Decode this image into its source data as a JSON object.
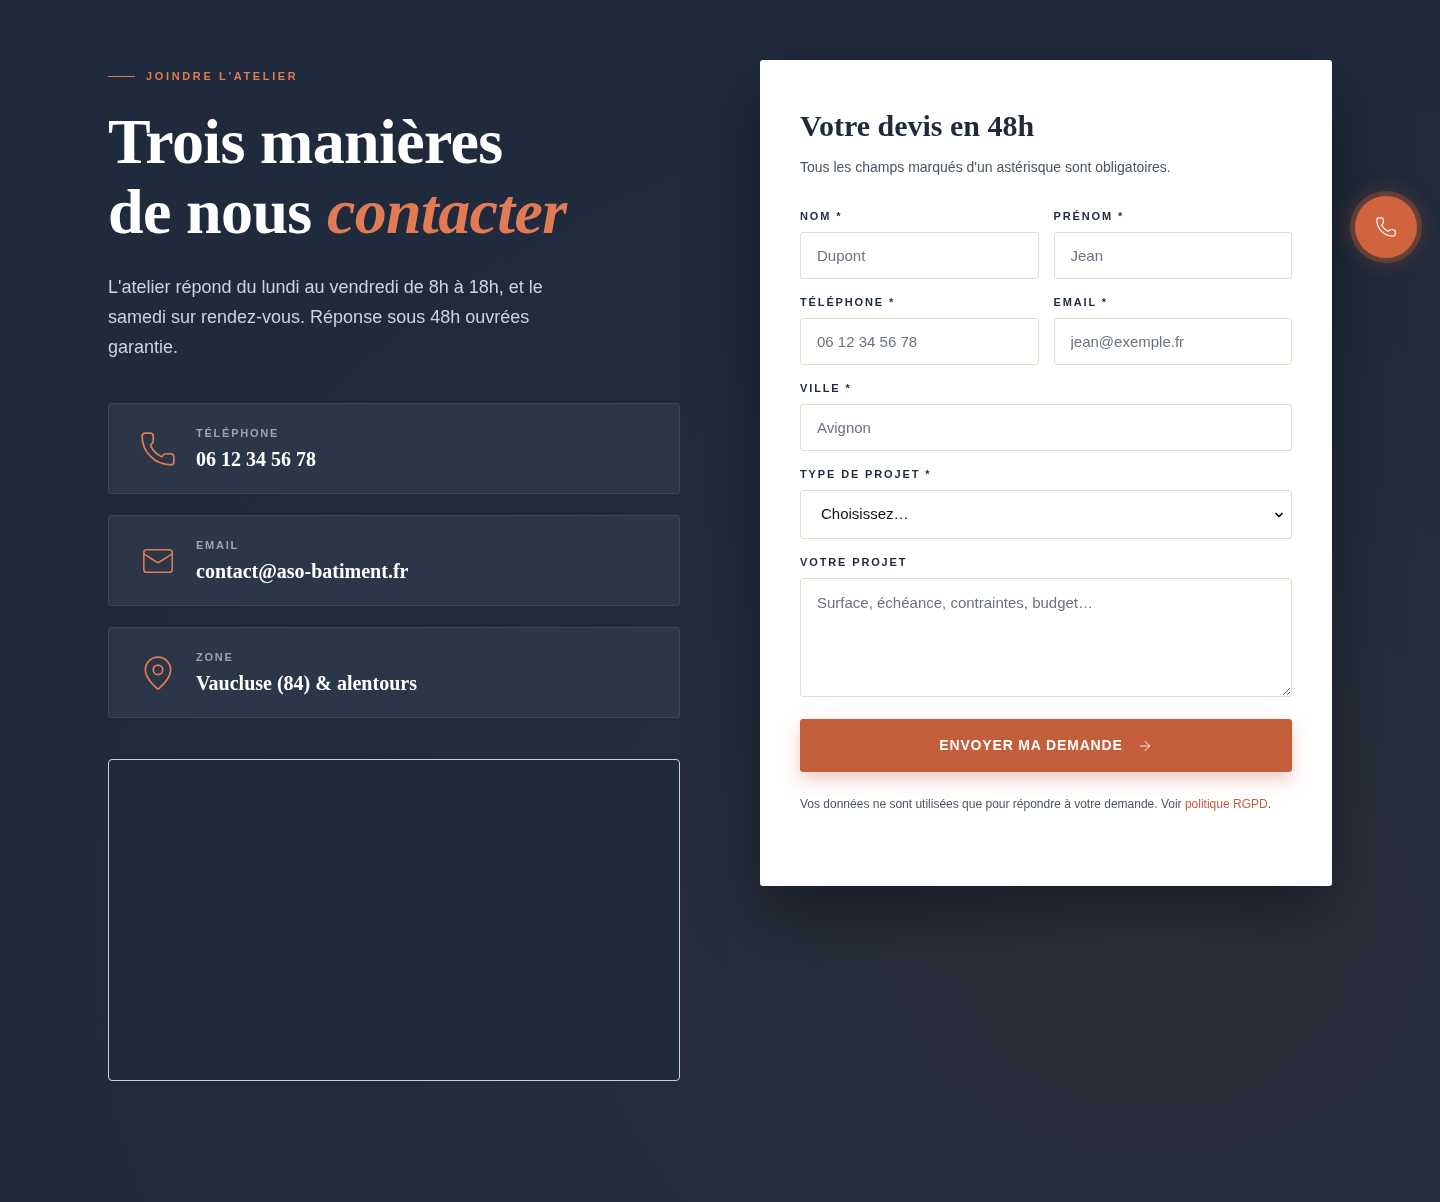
{
  "eyebrow": "JOINDRE L'ATELIER",
  "heading_lines": [
    "Trois manières",
    "de nous *contacter*"
  ],
  "intro": "L'atelier répond du lundi au vendredi de 8h à 18h, et le samedi sur rendez-vous. Réponse sous 48h ouvrées garantie.",
  "contact_cards": [
    {
      "kind": "phone",
      "label": "TÉLÉPHONE",
      "value": "06 12 34 56 78"
    },
    {
      "kind": "email",
      "label": "EMAIL",
      "value": "contact@aso-batiment.fr"
    },
    {
      "kind": "location",
      "label": "ZONE",
      "value": "Vaucluse (84) & alentours"
    }
  ],
  "form": {
    "title": "Votre devis en 48h",
    "note": "Tous les champs marqués d'un astérisque sont obligatoires.",
    "rows": [
      [
        {
          "kind": "input",
          "label": "NOM *",
          "placeholder": "Dupont"
        },
        {
          "kind": "input",
          "label": "PRÉNOM *",
          "placeholder": "Jean"
        }
      ],
      [
        {
          "kind": "input",
          "label": "TÉLÉPHONE *",
          "placeholder": "06 12 34 56 78"
        },
        {
          "kind": "input",
          "label": "EMAIL *",
          "placeholder": "jean@exemple.fr"
        }
      ],
      [
        {
          "kind": "input",
          "label": "VILLE *",
          "placeholder": "Avignon"
        }
      ],
      [
        {
          "kind": "select",
          "label": "TYPE DE PROJET *",
          "value": "Choisissez…"
        }
      ],
      [
        {
          "kind": "textarea",
          "label": "VOTRE PROJET",
          "placeholder": "Surface, échéance, contraintes, budget…"
        }
      ]
    ],
    "submit": "ENVOYER MA DEMANDE",
    "privacy_note": {
      "text": "Vos données ne sont utilisées que pour répondre à votre demande. Voir",
      "link": "politique RGPD",
      "end": "."
    }
  }
}
